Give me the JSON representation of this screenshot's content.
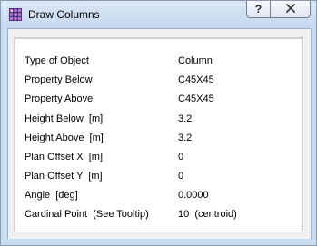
{
  "window": {
    "title": "Draw Columns",
    "app_icon": "grid-app-icon",
    "help_label": "?",
    "close_icon": "close-icon"
  },
  "properties": [
    {
      "label": "Type of Object",
      "value": "Column"
    },
    {
      "label": "Property Below",
      "value": "C45X45"
    },
    {
      "label": "Property Above",
      "value": "C45X45"
    },
    {
      "label": "Height Below  [m]",
      "value": "3.2"
    },
    {
      "label": "Height Above  [m]",
      "value": "3.2"
    },
    {
      "label": "Plan Offset X  [m]",
      "value": "0"
    },
    {
      "label": "Plan Offset Y  [m]",
      "value": "0"
    },
    {
      "label": "Angle  [deg]",
      "value": "0.0000"
    },
    {
      "label": "Cardinal Point  (See Tooltip)",
      "value": "10  (centroid)"
    }
  ]
}
